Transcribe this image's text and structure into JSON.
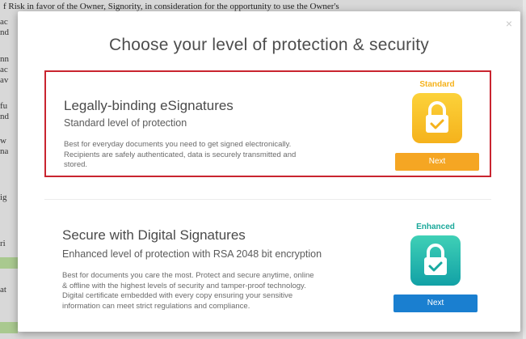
{
  "background": {
    "top_line": "f Risk in favor of the Owner, Signority, in consideration for the opportunity to use the Owner's",
    "fragments": [
      "ac",
      "nd",
      "nn",
      "ac",
      "av",
      "fu",
      "nd",
      "w",
      "na",
      "ig",
      "ri",
      "at"
    ]
  },
  "modal": {
    "title": "Choose your level of protection & security",
    "close_glyph": "×"
  },
  "options": [
    {
      "title": "Legally-binding eSignatures",
      "subtitle": "Standard level of protection",
      "description_lines": [
        "Best for everyday documents you need to get signed electronically.",
        "Recipients are safely authenticated, data is securely transmitted and",
        "stored."
      ],
      "tier": "Standard",
      "tier_color": "#f5b21c",
      "icon": "lock-check-icon",
      "button_label": "Next",
      "button_color": "#f5a623",
      "selected": true
    },
    {
      "title": "Secure with Digital Signatures",
      "subtitle": "Enhanced level of protection with RSA 2048 bit encryption",
      "description_lines": [
        "Best for documents you care the most. Protect and secure anytime, online",
        "& offline with the highest levels of security and tamper-proof technology.",
        "Digital certificate embedded with every copy ensuring your sensitive",
        "information can meet strict regulations and compliance."
      ],
      "tier": "Enhanced",
      "tier_color": "#1aa89a",
      "icon": "lock-check-icon",
      "button_label": "Next",
      "button_color": "#1a7fd0",
      "selected": false
    }
  ]
}
